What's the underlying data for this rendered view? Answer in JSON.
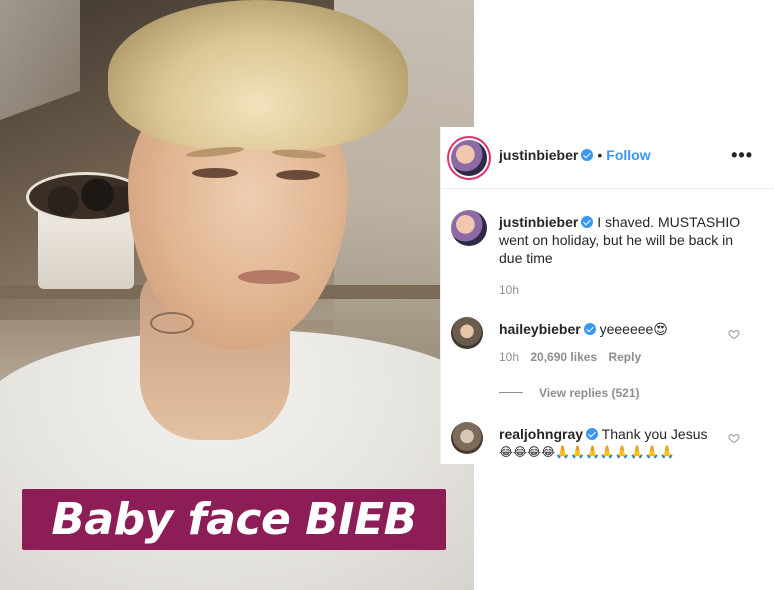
{
  "photo": {
    "sticker_text": "Baby face BIEB"
  },
  "header": {
    "username": "justinbieber",
    "separator": "•",
    "follow_label": "Follow",
    "more_label": "•••"
  },
  "caption": {
    "username": "justinbieber",
    "text_line1": "I shaved. MUSTASHIO",
    "text_line2": "went on holiday, but he will be back in",
    "text_line3": "due time",
    "time": "10h"
  },
  "comments": [
    {
      "username": "haileybieber",
      "text": "yeeeeee😍",
      "time": "10h",
      "likes": "20,690 likes",
      "reply_label": "Reply",
      "view_replies": "View replies (521)"
    },
    {
      "username": "realjohngray",
      "text_line1": "Thank you Jesus",
      "text_line2": "😂😂😂😂🙏🙏🙏🙏🙏🙏🙏🙏"
    }
  ],
  "colors": {
    "accent_blue": "#3897f0",
    "sticker_bg": "#8c1d56",
    "muted_text": "#8e8e8e"
  }
}
